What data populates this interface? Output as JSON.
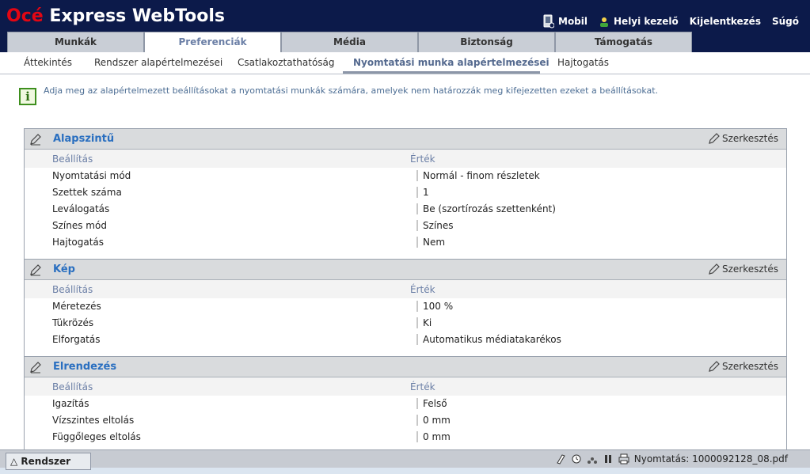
{
  "header": {
    "logo_brand": "Océ",
    "logo_rest": " Express WebTools",
    "links": [
      "Mobil",
      "Helyi kezelő",
      "Kijelentkezés",
      "Súgó"
    ]
  },
  "tabs": [
    "Munkák",
    "Preferenciák",
    "Média",
    "Biztonság",
    "Támogatás"
  ],
  "subnav": [
    "Áttekintés",
    "Rendszer alapértelmezései",
    "Csatlakoztathatóság",
    "Nyomtatási munka alapértelmezései",
    "Hajtogatás"
  ],
  "info": "Adja meg az alapértelmezett beállításokat a nyomtatási munkák számára, amelyek nem határozzák meg kifejezetten ezeket a beállításokat.",
  "sections": [
    {
      "title": "Alapszintű",
      "edit": "Szerkesztés",
      "col_setting": "Beállítás",
      "col_value": "Érték",
      "rows": [
        {
          "label": "Nyomtatási mód",
          "value": "Normál - finom részletek"
        },
        {
          "label": "Szettek száma",
          "value": "1"
        },
        {
          "label": "Leválogatás",
          "value": "Be (szortírozás szettenként)"
        },
        {
          "label": "Színes mód",
          "value": "Színes"
        },
        {
          "label": "Hajtogatás",
          "value": "Nem"
        }
      ]
    },
    {
      "title": "Kép",
      "edit": "Szerkesztés",
      "col_setting": "Beállítás",
      "col_value": "Érték",
      "rows": [
        {
          "label": "Méretezés",
          "value": "100 %"
        },
        {
          "label": "Tükrözés",
          "value": "Ki"
        },
        {
          "label": "Elforgatás",
          "value": "Automatikus médiatakarékos"
        }
      ]
    },
    {
      "title": "Elrendezés",
      "edit": "Szerkesztés",
      "col_setting": "Beállítás",
      "col_value": "Érték",
      "rows": [
        {
          "label": "Igazítás",
          "value": "Felső"
        },
        {
          "label": "Vízszintes eltolás",
          "value": "0 mm"
        },
        {
          "label": "Függőleges eltolás",
          "value": "0 mm"
        }
      ]
    }
  ],
  "statusbar": {
    "system_tab": "Rendszer",
    "print_status": "Nyomtatás: 1000092128_08.pdf"
  }
}
